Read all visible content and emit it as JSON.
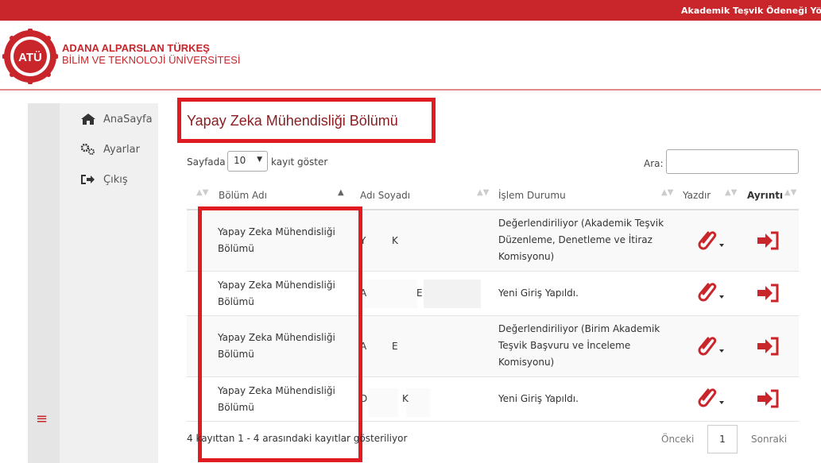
{
  "topbar": {
    "title": "Akademik Teşvik Ödeneği Yönet"
  },
  "brand": {
    "logo_text": "ATÜ",
    "line1": "ADANA ALPARSLAN TÜRKEŞ",
    "line2": "BİLİM VE TEKNOLOJİ ÜNİVERSİTESİ",
    "color": "#c8262b"
  },
  "sidebar": {
    "items": [
      {
        "label": "AnaSayfa",
        "icon": "home-icon"
      },
      {
        "label": "Ayarlar",
        "icon": "gears-icon"
      },
      {
        "label": "Çıkış",
        "icon": "sign-out-icon"
      }
    ],
    "menu_icon": "≡"
  },
  "page": {
    "title": "Yapay Zeka Mühendisliği Bölümü"
  },
  "length_control": {
    "before": "Sayfada",
    "value": "10",
    "after": "kayıt göster"
  },
  "search": {
    "label": "Ara:",
    "value": ""
  },
  "table": {
    "headers": {
      "dept": "Bölüm Adı",
      "name": "Adı Soyadı",
      "status": "İşlem Durumu",
      "print": "Yazdır",
      "details": "Ayrıntı"
    },
    "rows": [
      {
        "dept_l1": "Yapay Zeka Mühendisliği",
        "dept_l2": "Bölümü",
        "name_a": "Y",
        "name_b": "K",
        "status_lines": [
          "Değerlendiriliyor (Akademik Teşvik",
          "Düzenleme, Denetleme ve İtiraz",
          "Komisyonu)"
        ]
      },
      {
        "dept_l1": "Yapay Zeka Mühendisliği",
        "dept_l2": "Bölümü",
        "name_a": "A",
        "name_b": "E",
        "status_lines": [
          "Yeni Giriş Yapıldı.",
          "",
          ""
        ]
      },
      {
        "dept_l1": "Yapay Zeka Mühendisliği",
        "dept_l2": "Bölümü",
        "name_a": "A",
        "name_b": "E",
        "status_lines": [
          "Değerlendiriliyor (Birim Akademik",
          "Teşvik Başvuru ve İnceleme",
          "Komisyonu)"
        ]
      },
      {
        "dept_l1": "Yapay Zeka Mühendisliği",
        "dept_l2": "Bölümü",
        "name_a": "D",
        "name_b": "K",
        "status_lines": [
          "Yeni Giriş Yapıldı.",
          "",
          ""
        ]
      }
    ]
  },
  "footer": {
    "info": "4 kayıttan 1 - 4 arasındaki kayıtlar gösteriliyor",
    "prev": "Önceki",
    "page": "1",
    "next": "Sonraki"
  },
  "colors": {
    "accent": "#c8262b",
    "highlight": "#e11b22"
  }
}
